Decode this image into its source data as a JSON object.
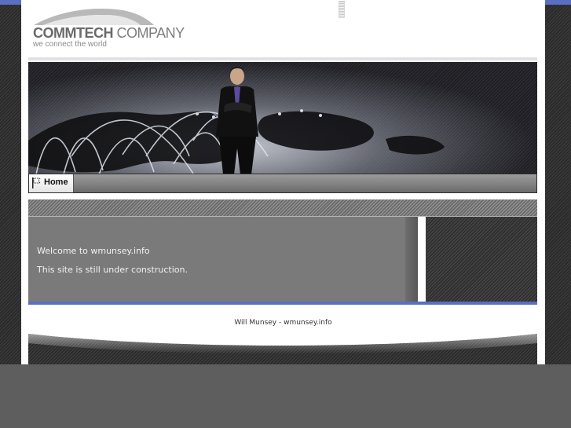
{
  "header": {
    "logo": {
      "brand_bold": "COMMTECH",
      "brand_light": " COMPANY",
      "tagline": "we connect the world"
    }
  },
  "nav": {
    "items": [
      {
        "label": "Home",
        "icon": "flag-icon"
      }
    ]
  },
  "content": {
    "lines": [
      "Welcome to wmunsey.info",
      "This site is still under construction."
    ]
  },
  "footer": {
    "text": "Will Munsey - wmunsey.info"
  },
  "colors": {
    "accent": "#5a6fc4",
    "page_background": "#5e5e5e",
    "content_panel": "#7a7a7a"
  }
}
